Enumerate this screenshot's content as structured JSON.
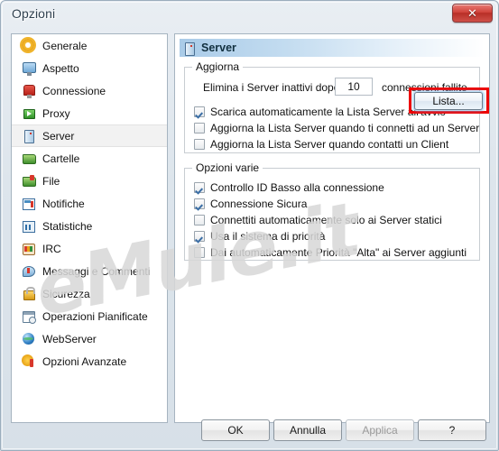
{
  "window": {
    "title": "Opzioni",
    "close_label": "✕",
    "close_icon": "close-icon"
  },
  "sidebar": {
    "items": [
      {
        "label": "Generale",
        "icon": "gear-icon",
        "selected": false
      },
      {
        "label": "Aspetto",
        "icon": "monitor-icon",
        "selected": false
      },
      {
        "label": "Connessione",
        "icon": "plug-icon",
        "selected": false
      },
      {
        "label": "Proxy",
        "icon": "proxy-icon",
        "selected": false
      },
      {
        "label": "Server",
        "icon": "server-icon",
        "selected": true
      },
      {
        "label": "Cartelle",
        "icon": "folder-icon",
        "selected": false
      },
      {
        "label": "File",
        "icon": "file-folder-icon",
        "selected": false
      },
      {
        "label": "Notifiche",
        "icon": "notification-icon",
        "selected": false
      },
      {
        "label": "Statistiche",
        "icon": "statistics-icon",
        "selected": false
      },
      {
        "label": "IRC",
        "icon": "irc-icon",
        "selected": false
      },
      {
        "label": "Messaggi e Commenti",
        "icon": "message-icon",
        "selected": false
      },
      {
        "label": "Sicurezza",
        "icon": "lock-icon",
        "selected": false
      },
      {
        "label": "Operazioni Pianificate",
        "icon": "calendar-icon",
        "selected": false
      },
      {
        "label": "WebServer",
        "icon": "globe-icon",
        "selected": false
      },
      {
        "label": "Opzioni Avanzate",
        "icon": "advanced-gear-icon",
        "selected": false
      }
    ]
  },
  "page": {
    "header_title": "Server",
    "header_icon": "server-icon",
    "groups": {
      "aggiorna": {
        "title": "Aggiorna",
        "spinner_prefix": "Elimina i Server inattivi dopo",
        "spinner_value": "10",
        "spinner_suffix": "connessioni fallite",
        "checkboxes": [
          {
            "label": "Scarica automaticamente la Lista Server all'avvio",
            "checked": true
          },
          {
            "label": "Aggiorna la Lista Server quando ti connetti ad un Server",
            "checked": false
          },
          {
            "label": "Aggiorna la Lista Server quando contatti un Client",
            "checked": false
          }
        ],
        "lista_button": "Lista..."
      },
      "varie": {
        "title": "Opzioni varie",
        "checkboxes": [
          {
            "label": "Controllo ID Basso alla connessione",
            "checked": true
          },
          {
            "label": "Connessione Sicura",
            "checked": true
          },
          {
            "label": "Connettiti automaticamente solo ai Server statici",
            "checked": false
          },
          {
            "label": "Usa il sistema di priorità",
            "checked": true
          },
          {
            "label": "Dai automaticamente Priorità \"Alta\" ai Server aggiunti",
            "checked": false
          }
        ]
      }
    }
  },
  "footer": {
    "ok": "OK",
    "cancel": "Annulla",
    "apply": "Applica",
    "help": "?"
  },
  "watermark": {
    "text": "eMule.it"
  },
  "colors": {
    "accent_red": "#ee0000",
    "header_blue": "#a9cbe8",
    "close_red": "#c9362e"
  }
}
